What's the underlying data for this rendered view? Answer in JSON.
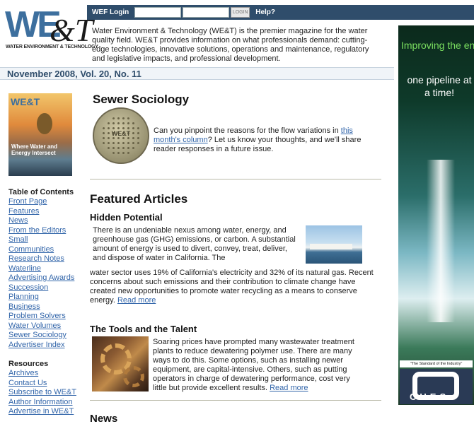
{
  "brand": {
    "logo_text": "WE&T",
    "logo_subtext": "WATER ENVIRONMENT & TECHNOLOGY"
  },
  "login": {
    "label": "WEF Login",
    "username_value": "",
    "password_value": "",
    "button_label": "LOGIN",
    "help_label": "Help?"
  },
  "intro_text": "Water Environment & Technology (WE&T) is the premier magazine for the water quality field. WE&T provides information on what professionals demand: cutting-edge technologies, innovative solutions, operations and maintenance, regulatory and legislative impacts, and professional development.",
  "issue": "November 2008, Vol. 20, No. 11",
  "cover": {
    "masthead": "WE&T",
    "headline": "Where Water and Energy Intersect"
  },
  "sidebar": {
    "toc_heading": "Table of Contents",
    "toc_items": [
      "Front Page",
      "Features",
      "News",
      "From the Editors",
      "Small",
      "Communities",
      "Research Notes",
      "Waterline",
      "Advertising Awards",
      "Succession",
      "Planning",
      "Business",
      "Problem Solvers",
      "Water Volumes",
      "Sewer Sociology",
      "Advertiser Index"
    ],
    "resources_heading": "Resources",
    "resource_items": [
      "Archives",
      "Contact Us",
      "Subscribe to WE&T",
      "Author Information",
      "Advertise in WE&T"
    ]
  },
  "sewer": {
    "title": "Sewer Sociology",
    "text_before": "Can you pinpoint the reasons for the flow variations in ",
    "link": "this month's column",
    "text_after": "? Let us know your thoughts, and we'll share reader responses in a future issue.",
    "image_label": "WE&T"
  },
  "featured": {
    "heading": "Featured Articles",
    "articles": [
      {
        "title": "Hidden Potential",
        "body_wrapped": "There is an undeniable nexus among water, energy, and greenhouse gas (GHG) emissions, or carbon. A substantial amount of energy is used to divert, convey, treat, deliver, and dispose of water in California. The",
        "body_full": "water sector uses 19% of California's electricity and 32% of its natural gas. Recent concerns about such emissions and their contribution to climate change have created new opportunities to promote water recycling as a means to conserve energy.",
        "read_more": "Read more"
      },
      {
        "title": "The Tools and the Talent",
        "body": "Soaring prices have prompted many wastewater treatment plants to reduce dewatering polymer use. There are many ways to do this. Some options, such as installing newer equipment, are capital-intensive. Others, such as putting operators in charge of dewatering performance, cost very little but provide excellent results.",
        "read_more": "Read more"
      }
    ]
  },
  "news_heading": "News",
  "ad": {
    "line1": "Improving the environment,",
    "line2": "one pipeline at a time!",
    "tagline": "\"The Standard of the Industry\"",
    "brand": "CUES"
  }
}
